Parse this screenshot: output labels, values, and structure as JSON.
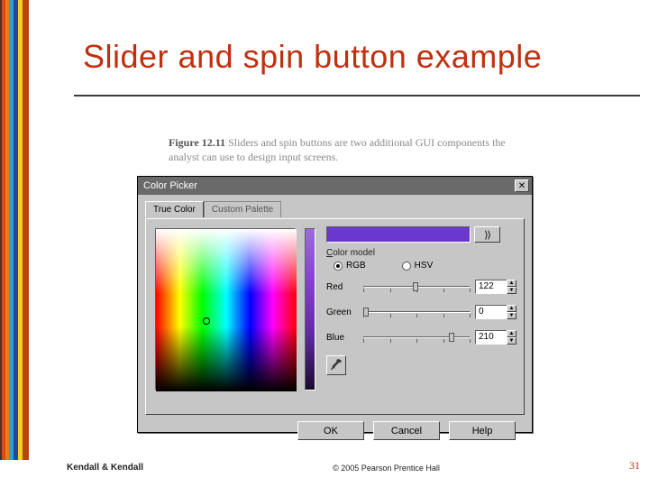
{
  "slide": {
    "title": "Slider and spin button example",
    "caption_fignum": "Figure 12.11",
    "caption_text": " Sliders and spin buttons are two additional GUI components the analyst can use to design input screens."
  },
  "dialog": {
    "title": "Color Picker",
    "close_label": "✕",
    "tabs": {
      "true_color": "True Color",
      "custom_palette": "Custom Palette"
    },
    "add_label": "⟩⟩",
    "color_model_label": "Color model",
    "rgb_label": "RGB",
    "hsv_label": "HSV",
    "red": {
      "label": "Red",
      "value": "122"
    },
    "green": {
      "label": "Green",
      "value": "0"
    },
    "blue": {
      "label": "Blue",
      "value": "210"
    },
    "swatch_color": "#6a37cf",
    "buttons": {
      "ok": "OK",
      "cancel": "Cancel",
      "help": "Help"
    }
  },
  "footer": {
    "byline": "Kendall & Kendall",
    "copyright": "© 2005 Pearson Prentice Hall",
    "page": "31"
  }
}
